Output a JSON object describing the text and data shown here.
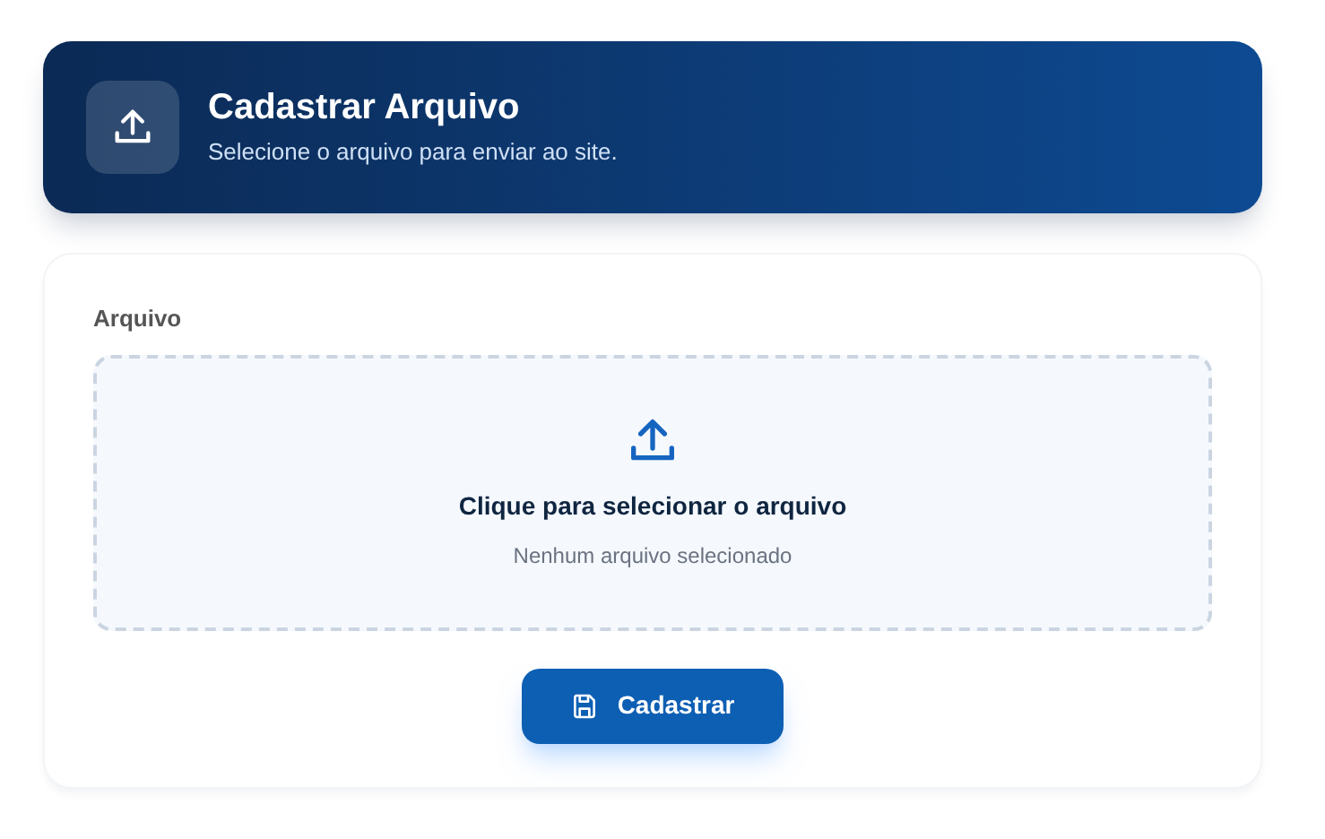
{
  "header": {
    "title": "Cadastrar Arquivo",
    "subtitle": "Selecione o arquivo para enviar ao site."
  },
  "form": {
    "label": "Arquivo",
    "dropzone": {
      "prompt": "Clique para selecionar o arquivo",
      "status": "Nenhum arquivo selecionado"
    },
    "submit": "Cadastrar"
  }
}
